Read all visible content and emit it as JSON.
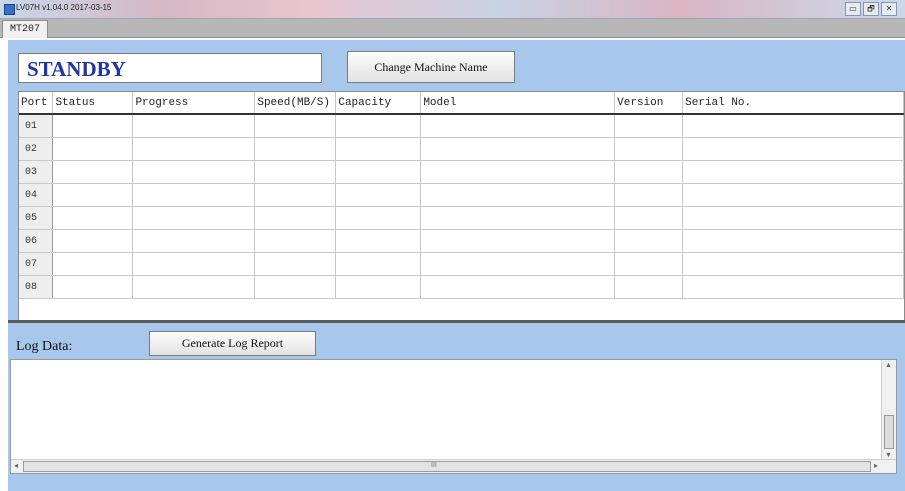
{
  "window": {
    "title": "LV07H v1.04.0 2017-03-15",
    "controls": {
      "minimize": "▭",
      "maximize": "🗗",
      "close": "✕"
    }
  },
  "tabs": [
    {
      "label": "MT207"
    }
  ],
  "status": {
    "text": "STANDBY",
    "color": "#1f34a6"
  },
  "buttons": {
    "change_machine_name": "Change Machine Name",
    "generate_log_report": "Generate Log Report"
  },
  "table": {
    "columns": [
      "Port",
      "Status",
      "Progress",
      "Speed(MB/S)",
      "Capacity",
      "Model",
      "Version",
      "Serial No."
    ],
    "rows": [
      {
        "port": "01",
        "status": "",
        "progress": "",
        "speed": "",
        "capacity": "",
        "model": "",
        "version": "",
        "serial": ""
      },
      {
        "port": "02",
        "status": "",
        "progress": "",
        "speed": "",
        "capacity": "",
        "model": "",
        "version": "",
        "serial": ""
      },
      {
        "port": "03",
        "status": "",
        "progress": "",
        "speed": "",
        "capacity": "",
        "model": "",
        "version": "",
        "serial": ""
      },
      {
        "port": "04",
        "status": "",
        "progress": "",
        "speed": "",
        "capacity": "",
        "model": "",
        "version": "",
        "serial": ""
      },
      {
        "port": "05",
        "status": "",
        "progress": "",
        "speed": "",
        "capacity": "",
        "model": "",
        "version": "",
        "serial": ""
      },
      {
        "port": "06",
        "status": "",
        "progress": "",
        "speed": "",
        "capacity": "",
        "model": "",
        "version": "",
        "serial": ""
      },
      {
        "port": "07",
        "status": "",
        "progress": "",
        "speed": "",
        "capacity": "",
        "model": "",
        "version": "",
        "serial": ""
      },
      {
        "port": "08",
        "status": "",
        "progress": "",
        "speed": "",
        "capacity": "",
        "model": "",
        "version": "",
        "serial": ""
      }
    ]
  },
  "log": {
    "label": "Log Data:",
    "content": ""
  },
  "scroll": {
    "grip": "III"
  },
  "colors": {
    "panel_bg": "#a7c7ec",
    "status_text": "#1f34a6",
    "divider": "#5a5a5a"
  }
}
